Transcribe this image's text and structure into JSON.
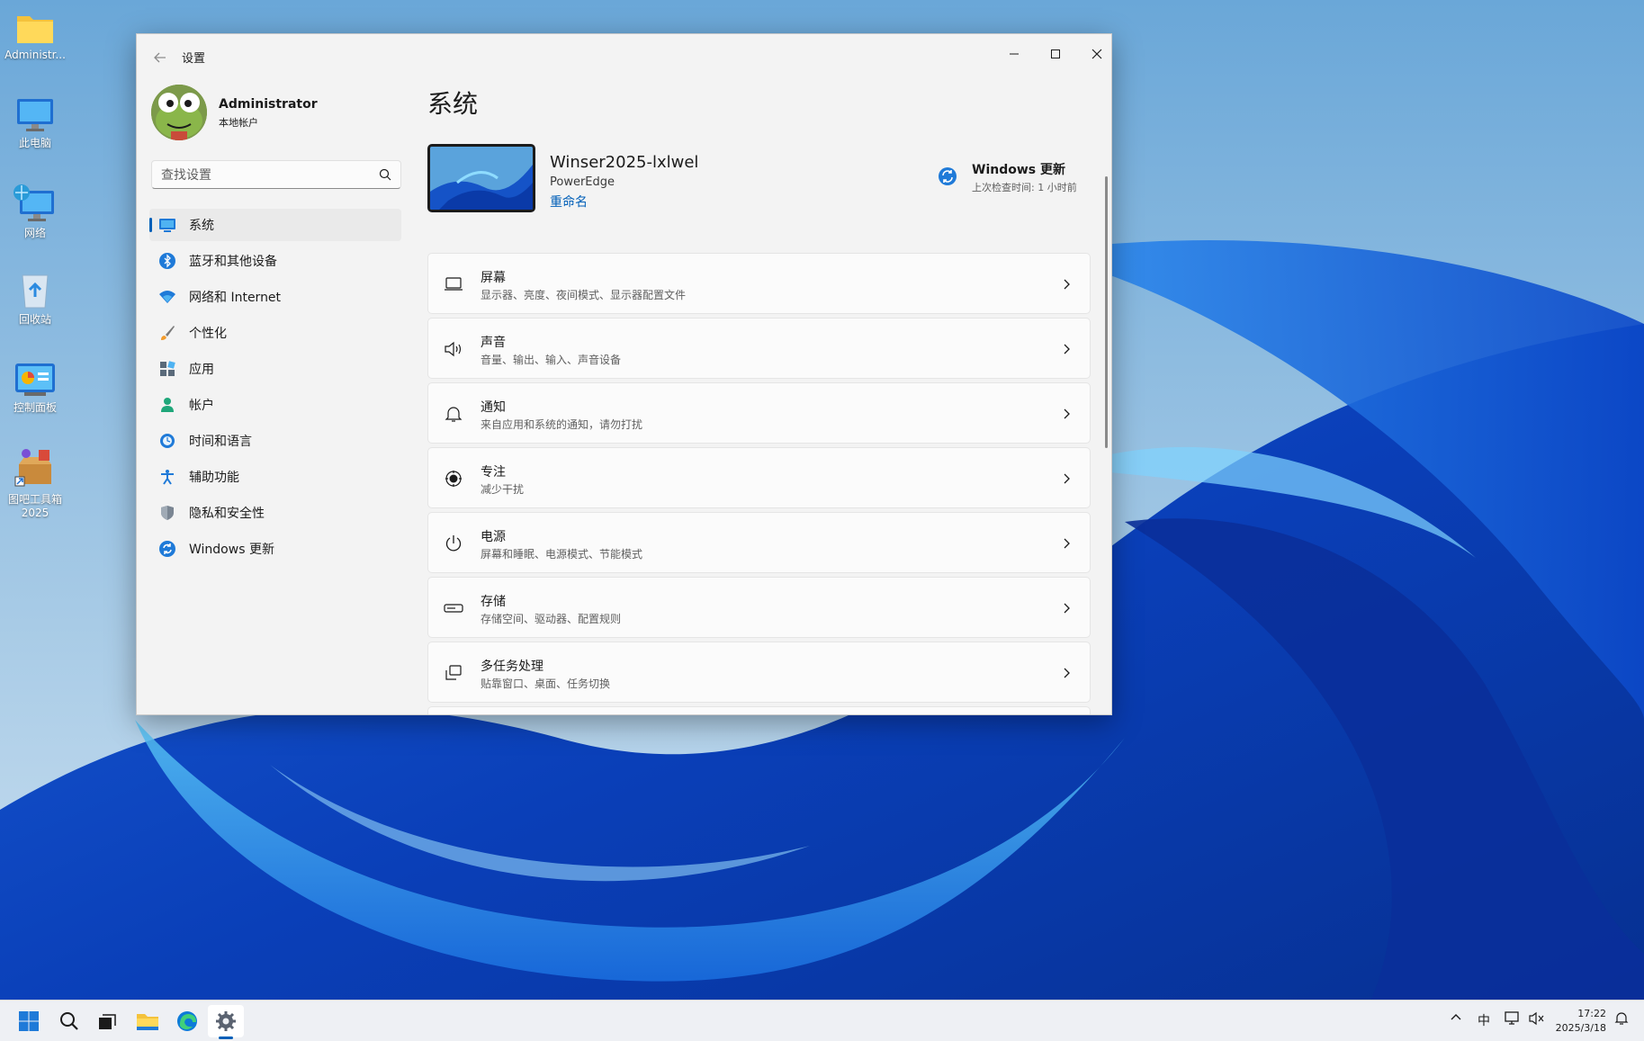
{
  "desktop": {
    "icons": [
      {
        "label": "Administr...",
        "icon": "folder-icon"
      },
      {
        "label": "此电脑",
        "icon": "computer-icon"
      },
      {
        "label": "网络",
        "icon": "network-icon"
      },
      {
        "label": "回收站",
        "icon": "recycle-bin-icon"
      },
      {
        "label": "控制面板",
        "icon": "control-panel-icon"
      },
      {
        "label": "图吧工具箱",
        "label2": "2025",
        "icon": "toolbox-icon"
      }
    ]
  },
  "window": {
    "title": "设置",
    "back": "←"
  },
  "user": {
    "name": "Administrator",
    "account_type": "本地帐户"
  },
  "search": {
    "placeholder": "查找设置"
  },
  "nav": {
    "items": [
      {
        "label": "系统",
        "icon": "system-icon",
        "active": true
      },
      {
        "label": "蓝牙和其他设备",
        "icon": "bluetooth-icon"
      },
      {
        "label": "网络和 Internet",
        "icon": "wifi-icon"
      },
      {
        "label": "个性化",
        "icon": "brush-icon"
      },
      {
        "label": "应用",
        "icon": "apps-icon"
      },
      {
        "label": "帐户",
        "icon": "account-icon"
      },
      {
        "label": "时间和语言",
        "icon": "time-language-icon"
      },
      {
        "label": "辅助功能",
        "icon": "accessibility-icon"
      },
      {
        "label": "隐私和安全性",
        "icon": "shield-icon"
      },
      {
        "label": "Windows 更新",
        "icon": "windows-update-icon"
      }
    ]
  },
  "main": {
    "title": "系统",
    "device": {
      "name": "Winser2025-lxlwel",
      "model": "PowerEdge",
      "rename": "重命名"
    },
    "update": {
      "title": "Windows 更新",
      "subtitle": "上次检查时间: 1 小时前"
    },
    "items": [
      {
        "title": "屏幕",
        "subtitle": "显示器、亮度、夜间模式、显示器配置文件",
        "icon": "display-icon"
      },
      {
        "title": "声音",
        "subtitle": "音量、输出、输入、声音设备",
        "icon": "sound-icon"
      },
      {
        "title": "通知",
        "subtitle": "来自应用和系统的通知，请勿打扰",
        "icon": "bell-icon"
      },
      {
        "title": "专注",
        "subtitle": "减少干扰",
        "icon": "focus-icon"
      },
      {
        "title": "电源",
        "subtitle": "屏幕和睡眠、电源模式、节能模式",
        "icon": "power-icon"
      },
      {
        "title": "存储",
        "subtitle": "存储空间、驱动器、配置规则",
        "icon": "storage-icon"
      },
      {
        "title": "多任务处理",
        "subtitle": "贴靠窗口、桌面、任务切换",
        "icon": "multitasking-icon"
      }
    ]
  },
  "taskbar": {
    "ime": "中",
    "time": "17:22",
    "date": "2025/3/18"
  },
  "colors": {
    "accent": "#005fb8",
    "window_bg": "#f3f3f3",
    "card_bg": "#fbfbfb"
  }
}
